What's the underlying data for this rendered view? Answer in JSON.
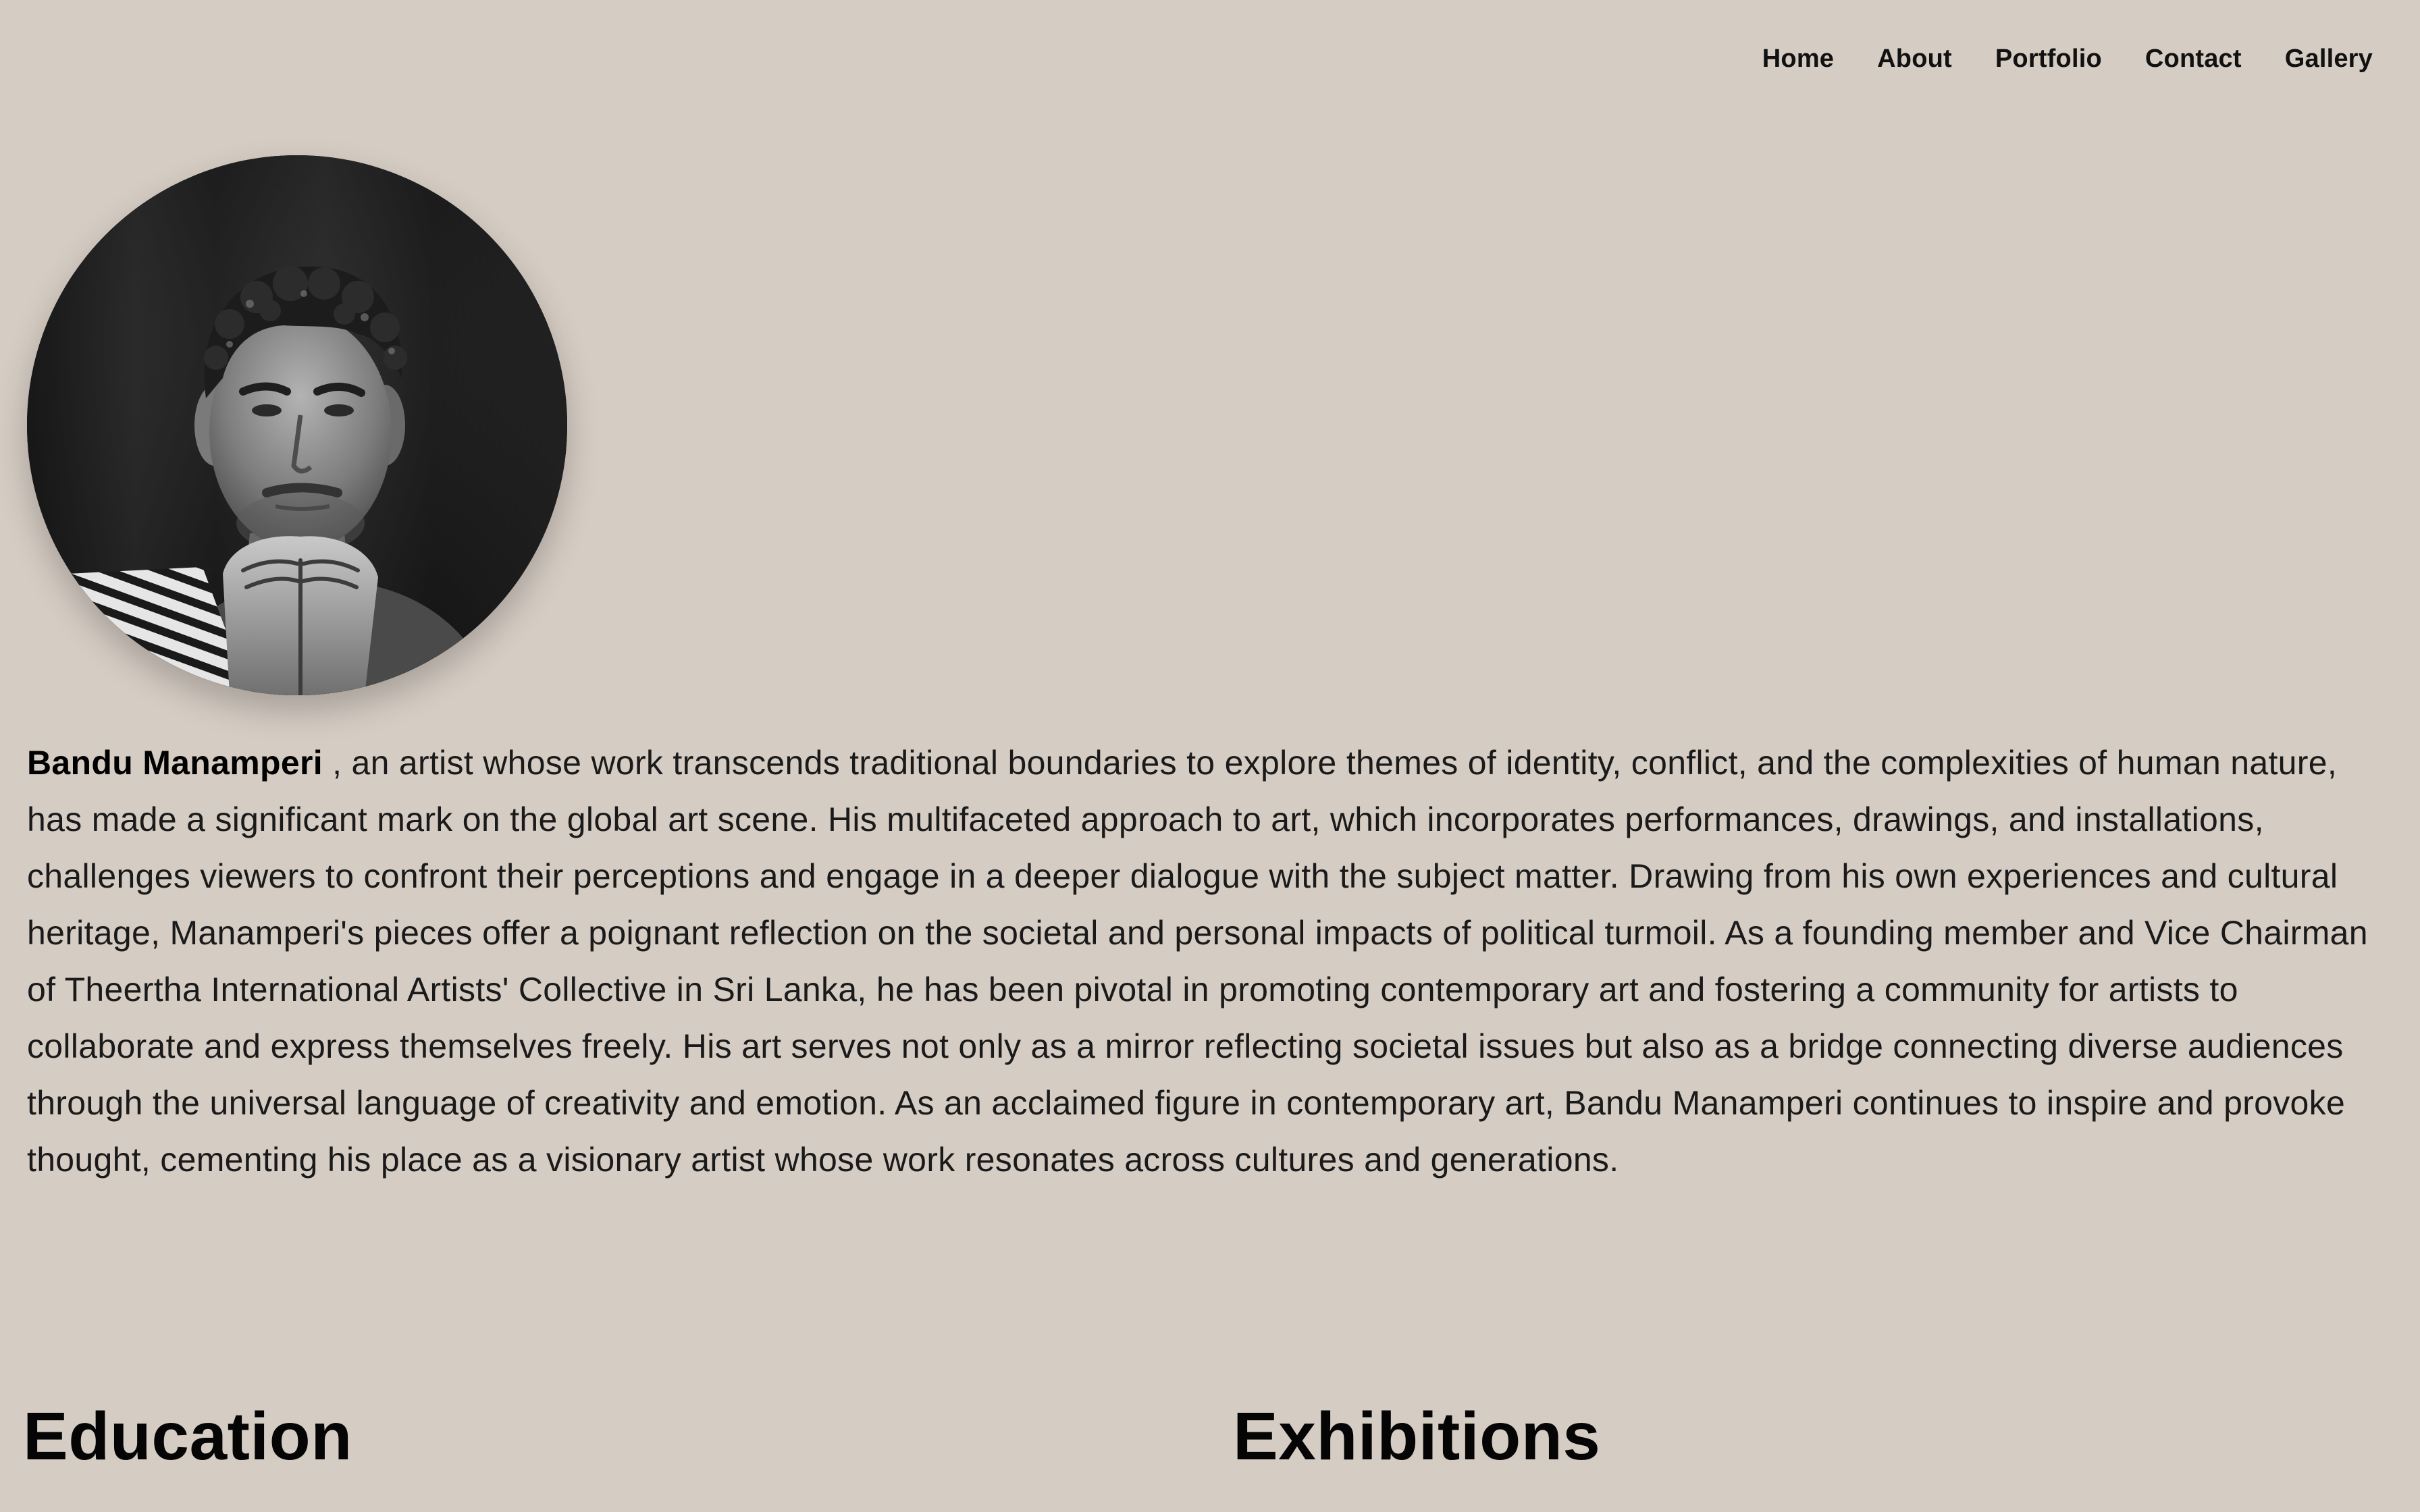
{
  "nav": {
    "items": [
      {
        "label": "Home"
      },
      {
        "label": "About"
      },
      {
        "label": "Portfolio"
      },
      {
        "label": "Contact"
      },
      {
        "label": "Gallery"
      }
    ]
  },
  "profile": {
    "name": "Bandu Manamperi",
    "bio": " , an artist whose work transcends traditional boundaries to explore themes of identity, conflict, and the complexities of human nature, has made a significant mark on the global art scene. His multifaceted approach to art, which incorporates performances, drawings, and installations, challenges viewers to confront their perceptions and engage in a deeper dialogue with the subject matter. Drawing from his own experiences and cultural heritage, Manamperi's pieces offer a poignant reflection on the societal and personal impacts of political turmoil. As a founding member and Vice Chairman of Theertha International Artists' Collective in Sri Lanka, he has been pivotal in promoting contemporary art and fostering a community for artists to collaborate and express themselves freely. His art serves not only as a mirror reflecting societal issues but also as a bridge connecting diverse audiences through the universal language of creativity and emotion. As an acclaimed figure in contemporary art, Bandu Manamperi continues to inspire and provoke thought, cementing his place as a visionary artist whose work resonates across cultures and generations."
  },
  "sections": {
    "education": {
      "title": "Education"
    },
    "exhibitions": {
      "title": "Exhibitions"
    }
  },
  "colors": {
    "background": "#d5ccc3",
    "text": "#141414",
    "heading": "#050505"
  }
}
